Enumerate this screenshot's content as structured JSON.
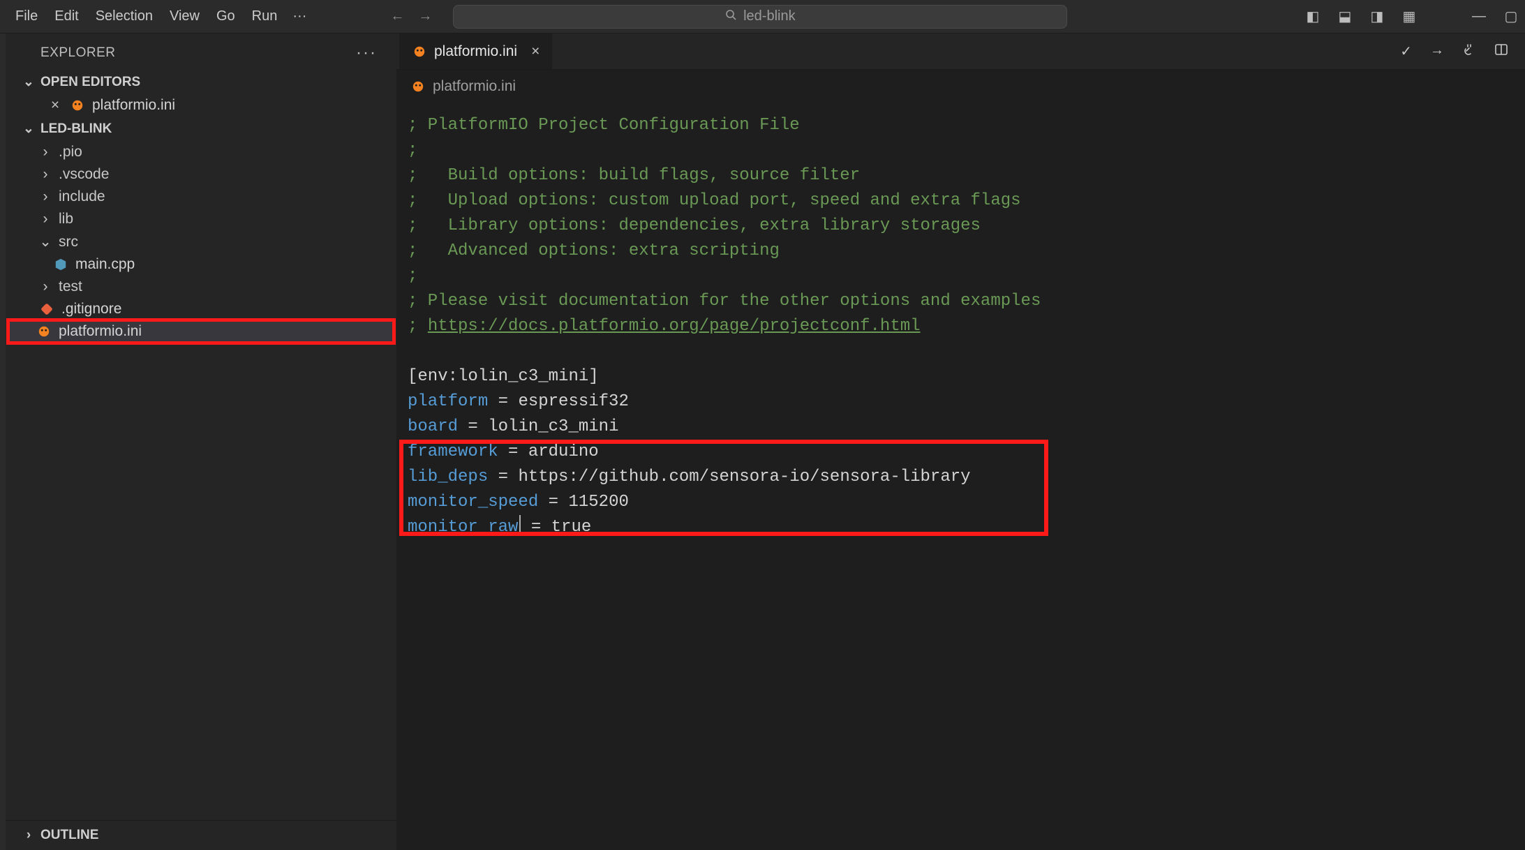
{
  "menubar": {
    "items": [
      "File",
      "Edit",
      "Selection",
      "View",
      "Go",
      "Run"
    ],
    "ellipsis": "···"
  },
  "titlebar": {
    "search_placeholder": "led-blink",
    "search_icon": "search-icon"
  },
  "sidebar": {
    "title": "EXPLORER",
    "more": "···",
    "open_editors_label": "OPEN EDITORS",
    "open_editors": [
      {
        "name": "platformio.ini",
        "icon": "platformio"
      }
    ],
    "project_label": "LED-BLINK",
    "tree": [
      {
        "name": ".pio",
        "type": "folder",
        "expanded": false
      },
      {
        "name": ".vscode",
        "type": "folder",
        "expanded": false
      },
      {
        "name": "include",
        "type": "folder",
        "expanded": false
      },
      {
        "name": "lib",
        "type": "folder",
        "expanded": false
      },
      {
        "name": "src",
        "type": "folder",
        "expanded": true,
        "children": [
          {
            "name": "main.cpp",
            "type": "file",
            "icon": "cpp"
          }
        ]
      },
      {
        "name": "test",
        "type": "folder",
        "expanded": false
      },
      {
        "name": ".gitignore",
        "type": "file",
        "icon": "git"
      },
      {
        "name": "platformio.ini",
        "type": "file",
        "icon": "platformio",
        "selected": true,
        "highlight": true
      }
    ],
    "outline_label": "OUTLINE"
  },
  "editor": {
    "tab": {
      "filename": "platformio.ini",
      "icon": "platformio",
      "close": "×"
    },
    "breadcrumb": {
      "filename": "platformio.ini",
      "icon": "platformio"
    },
    "toolbar_icons": [
      "check",
      "arrow-right",
      "plug",
      "split"
    ],
    "code": {
      "comment_lines": [
        "; PlatformIO Project Configuration File",
        ";",
        ";   Build options: build flags, source filter",
        ";   Upload options: custom upload port, speed and extra flags",
        ";   Library options: dependencies, extra library storages",
        ";   Advanced options: extra scripting",
        ";",
        "; Please visit documentation for the other options and examples"
      ],
      "doc_line_prefix": "; ",
      "doc_url": "https://docs.platformio.org/page/projectconf.html",
      "section_header": "[env:lolin_c3_mini]",
      "entries": [
        {
          "key": "platform",
          "value": "espressif32"
        },
        {
          "key": "board",
          "value": "lolin_c3_mini"
        },
        {
          "key": "framework",
          "value": "arduino"
        },
        {
          "key": "lib_deps",
          "value": "https://github.com/sensora-io/sensora-library",
          "hl": true
        },
        {
          "key": "monitor_speed",
          "value": "115200",
          "hl": true
        },
        {
          "key": "monitor_raw",
          "value": "true",
          "hl": true,
          "cursor_after_key": true
        }
      ]
    }
  },
  "glyphs": {
    "chev_down": "⌄",
    "chev_right": "›",
    "arrow_left": "←",
    "arrow_right": "→",
    "close": "×",
    "search": "🔍",
    "check": "✓",
    "upload_arrow": "→",
    "plug": "⎘",
    "split": "▥",
    "panel_left": "◧",
    "panel_bottom": "⬓",
    "panel_right": "◨",
    "layout": "▦",
    "win_min": "—",
    "win_max": "▢"
  }
}
